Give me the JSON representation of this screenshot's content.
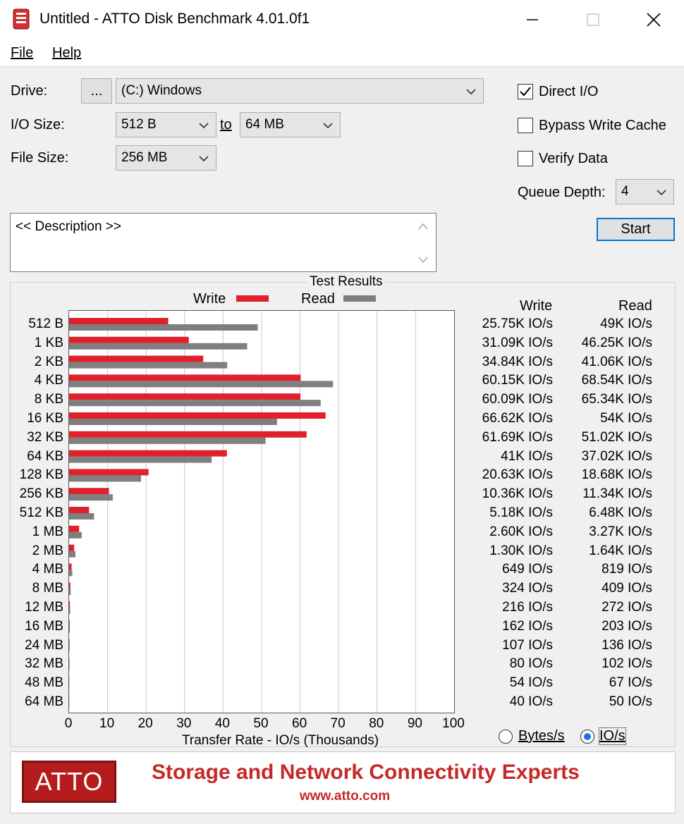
{
  "window": {
    "title": "Untitled - ATTO Disk Benchmark 4.01.0f1"
  },
  "menu": {
    "file": "File",
    "help": "Help"
  },
  "form": {
    "drive_label": "Drive:",
    "browse_label": "...",
    "drive_value": "(C:) Windows",
    "io_size_label": "I/O Size:",
    "io_size_from": "512 B",
    "to_label": "to",
    "io_size_to": "64 MB",
    "file_size_label": "File Size:",
    "file_size_value": "256 MB",
    "direct_io_label": "Direct I/O",
    "direct_io_checked": true,
    "bypass_label": "Bypass Write Cache",
    "bypass_checked": false,
    "verify_label": "Verify Data",
    "verify_checked": false,
    "queue_label": "Queue Depth:",
    "queue_value": "4",
    "start_label": "Start",
    "description": "<< Description >>"
  },
  "results": {
    "title": "Test Results",
    "write_legend": "Write",
    "read_legend": "Read",
    "write_header": "Write",
    "read_header": "Read",
    "write_values": [
      "25.75K IO/s",
      "31.09K IO/s",
      "34.84K IO/s",
      "60.15K IO/s",
      "60.09K IO/s",
      "66.62K IO/s",
      "61.69K IO/s",
      "41K IO/s",
      "20.63K IO/s",
      "10.36K IO/s",
      "5.18K IO/s",
      "2.60K IO/s",
      "1.30K IO/s",
      "649 IO/s",
      "324 IO/s",
      "216 IO/s",
      "162 IO/s",
      "107 IO/s",
      "80 IO/s",
      "54 IO/s",
      "40 IO/s"
    ],
    "read_values": [
      "49K IO/s",
      "46.25K IO/s",
      "41.06K IO/s",
      "68.54K IO/s",
      "65.34K IO/s",
      "54K IO/s",
      "51.02K IO/s",
      "37.02K IO/s",
      "18.68K IO/s",
      "11.34K IO/s",
      "6.48K IO/s",
      "3.27K IO/s",
      "1.64K IO/s",
      "819 IO/s",
      "409 IO/s",
      "272 IO/s",
      "203 IO/s",
      "136 IO/s",
      "102 IO/s",
      "67 IO/s",
      "50 IO/s"
    ],
    "bytes_label": "Bytes/s",
    "ios_label": "IO/s"
  },
  "chart_data": {
    "type": "bar",
    "orientation": "horizontal",
    "categories": [
      "512 B",
      "1 KB",
      "2 KB",
      "4 KB",
      "8 KB",
      "16 KB",
      "32 KB",
      "64 KB",
      "128 KB",
      "256 KB",
      "512 KB",
      "1 MB",
      "2 MB",
      "4 MB",
      "8 MB",
      "12 MB",
      "16 MB",
      "24 MB",
      "32 MB",
      "48 MB",
      "64 MB"
    ],
    "series": [
      {
        "name": "Write",
        "color": "#e0202a",
        "values": [
          25.75,
          31.09,
          34.84,
          60.15,
          60.09,
          66.62,
          61.69,
          41,
          20.63,
          10.36,
          5.18,
          2.6,
          1.3,
          0.649,
          0.324,
          0.216,
          0.162,
          0.107,
          0.08,
          0.054,
          0.04
        ]
      },
      {
        "name": "Read",
        "color": "#7f7f7f",
        "values": [
          49,
          46.25,
          41.06,
          68.54,
          65.34,
          54,
          51.02,
          37.02,
          18.68,
          11.34,
          6.48,
          3.27,
          1.64,
          0.819,
          0.409,
          0.272,
          0.203,
          0.136,
          0.102,
          0.067,
          0.05
        ]
      }
    ],
    "xticks": [
      "0",
      "10",
      "20",
      "30",
      "40",
      "50",
      "60",
      "70",
      "80",
      "90",
      "100"
    ],
    "xlim": [
      0,
      100
    ],
    "xlabel": "Transfer Rate - IO/s (Thousands)",
    "grid": true
  },
  "banner": {
    "logo": "ATTO",
    "tagline": "Storage and Network Connectivity Experts",
    "url": "www.atto.com"
  }
}
